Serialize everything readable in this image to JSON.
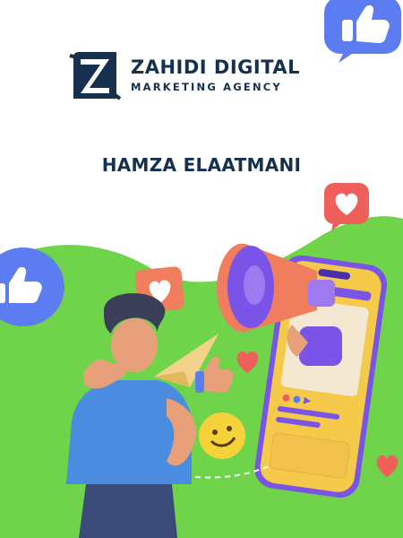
{
  "brand": {
    "name": "ZAHIDI DIGITAL",
    "tagline": "MARKETING AGENCY",
    "logo_letter": "Z",
    "colors": {
      "navy": "#15314f",
      "green": "#6fd449",
      "blue": "#5c7df2",
      "red": "#f0605a",
      "orange": "#f07e5e",
      "purple": "#7a54e6",
      "yellow": "#f5c94a"
    }
  },
  "author": {
    "name": "HAMZA ELAATMANI"
  },
  "icons": [
    "thumbs-up-icon",
    "heart-icon",
    "megaphone-icon",
    "smartphone-icon",
    "paper-plane-icon",
    "smiley-icon"
  ]
}
